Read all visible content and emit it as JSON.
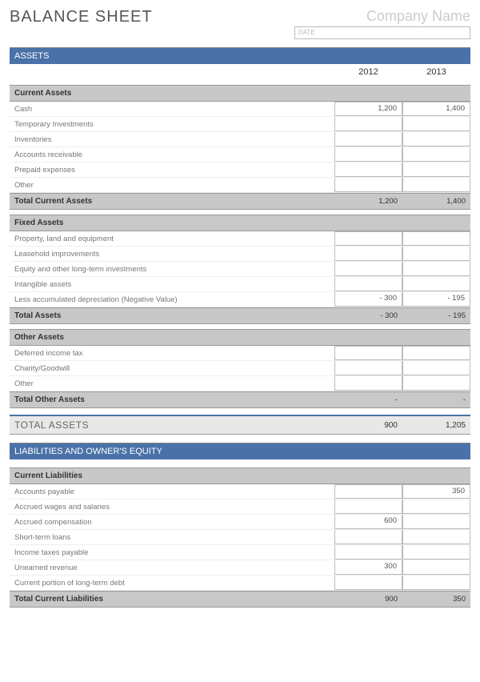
{
  "header": {
    "title": "BALANCE SHEET",
    "company": "Company Name",
    "date_placeholder": "DATE"
  },
  "years": {
    "y1": "2012",
    "y2": "2013"
  },
  "sections": {
    "assets": {
      "title": "ASSETS",
      "current": {
        "header": "Current Assets",
        "rows": [
          {
            "label": "Cash",
            "v1": "1,200",
            "v2": "1,400"
          },
          {
            "label": "Temporary Investments",
            "v1": "",
            "v2": ""
          },
          {
            "label": "Inventories",
            "v1": "",
            "v2": ""
          },
          {
            "label": "Accounts receivable",
            "v1": "",
            "v2": ""
          },
          {
            "label": "Prepaid expenses",
            "v1": "",
            "v2": ""
          },
          {
            "label": "Other",
            "v1": "",
            "v2": ""
          }
        ],
        "total": {
          "label": "Total Current Assets",
          "v1": "1,200",
          "v2": "1,400"
        }
      },
      "fixed": {
        "header": "Fixed Assets",
        "rows": [
          {
            "label": "Property, land and equipment",
            "v1": "",
            "v2": ""
          },
          {
            "label": "Leasehold improvements",
            "v1": "",
            "v2": ""
          },
          {
            "label": "Equity and other long-term investments",
            "v1": "",
            "v2": ""
          },
          {
            "label": "Intangible assets",
            "v1": "",
            "v2": ""
          },
          {
            "label": "Less accumulated depreciation (Negative Value)",
            "v1": "- 300",
            "v2": "- 195"
          }
        ],
        "total": {
          "label": "Total Assets",
          "v1": "- 300",
          "v2": "- 195"
        }
      },
      "other": {
        "header": "Other Assets",
        "rows": [
          {
            "label": "Deferred income tax",
            "v1": "",
            "v2": ""
          },
          {
            "label": "Charity/Goodwill",
            "v1": "",
            "v2": ""
          },
          {
            "label": "Other",
            "v1": "",
            "v2": ""
          }
        ],
        "total": {
          "label": "Total Other Assets",
          "v1": "-",
          "v2": "-"
        }
      },
      "grand": {
        "label": "TOTAL ASSETS",
        "v1": "900",
        "v2": "1,205"
      }
    },
    "liabilities": {
      "title": "LIABILITIES AND OWNER'S EQUITY",
      "current": {
        "header": "Current Liabilities",
        "rows": [
          {
            "label": "Accounts payable",
            "v1": "",
            "v2": "350"
          },
          {
            "label": "Accrued wages and salaries",
            "v1": "",
            "v2": ""
          },
          {
            "label": "Accrued compensation",
            "v1": "600",
            "v2": ""
          },
          {
            "label": "Short-term loans",
            "v1": "",
            "v2": ""
          },
          {
            "label": "Income taxes payable",
            "v1": "",
            "v2": ""
          },
          {
            "label": "Unearned revenue",
            "v1": "300",
            "v2": ""
          },
          {
            "label": "Current portion of long-term debt",
            "v1": "",
            "v2": ""
          }
        ],
        "total": {
          "label": "Total Current Liabilities",
          "v1": "900",
          "v2": "350"
        }
      }
    }
  }
}
